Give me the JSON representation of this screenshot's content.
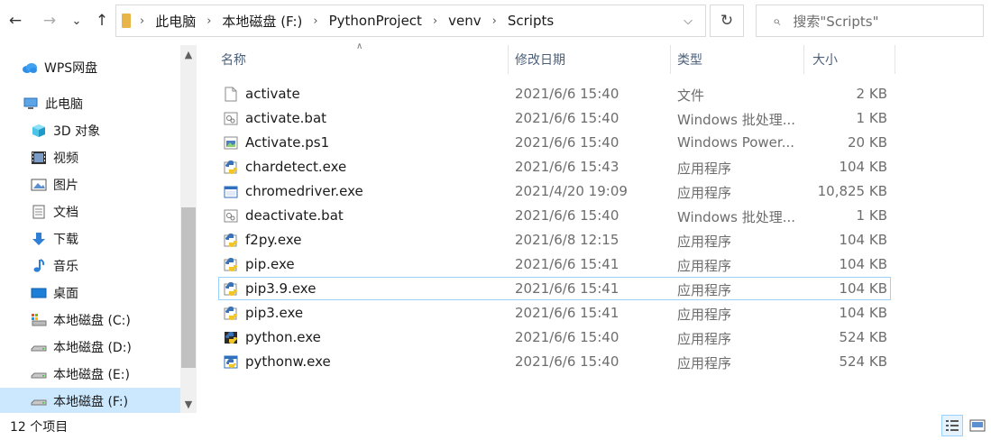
{
  "nav": {
    "back_glyph": "←",
    "forward_glyph": "→",
    "history_glyph": "⌄",
    "up_glyph": "↑",
    "refresh_glyph": "↻",
    "breadcrumbs": [
      "此电脑",
      "本地磁盘 (F:)",
      "PythonProject",
      "venv",
      "Scripts"
    ],
    "search_placeholder": "搜索\"Scripts\""
  },
  "sidebar": {
    "items": [
      {
        "label": "WPS网盘",
        "icon": "cloud-icon"
      },
      {
        "label": "此电脑",
        "icon": "computer-icon"
      },
      {
        "label": "3D 对象",
        "icon": "3d-objects-icon"
      },
      {
        "label": "视频",
        "icon": "video-icon"
      },
      {
        "label": "图片",
        "icon": "pictures-icon"
      },
      {
        "label": "文档",
        "icon": "documents-icon"
      },
      {
        "label": "下载",
        "icon": "download-icon"
      },
      {
        "label": "音乐",
        "icon": "music-icon"
      },
      {
        "label": "桌面",
        "icon": "desktop-icon"
      },
      {
        "label": "本地磁盘 (C:)",
        "icon": "system-drive-icon"
      },
      {
        "label": "本地磁盘 (D:)",
        "icon": "drive-icon"
      },
      {
        "label": "本地磁盘 (E:)",
        "icon": "drive-icon"
      },
      {
        "label": "本地磁盘 (F:)",
        "icon": "drive-icon",
        "selected": true
      }
    ]
  },
  "columns": {
    "name": "名称",
    "date": "修改日期",
    "type": "类型",
    "size": "大小"
  },
  "files": [
    {
      "name": "activate",
      "date": "2021/6/6 15:40",
      "type": "文件",
      "size": "2 KB",
      "icon": "file-icon"
    },
    {
      "name": "activate.bat",
      "date": "2021/6/6 15:40",
      "type": "Windows 批处理...",
      "size": "1 KB",
      "icon": "batch-file-icon"
    },
    {
      "name": "Activate.ps1",
      "date": "2021/6/6 15:40",
      "type": "Windows Power...",
      "size": "20 KB",
      "icon": "powershell-file-icon"
    },
    {
      "name": "chardetect.exe",
      "date": "2021/6/6 15:43",
      "type": "应用程序",
      "size": "104 KB",
      "icon": "python-exe-icon"
    },
    {
      "name": "chromedriver.exe",
      "date": "2021/4/20 19:09",
      "type": "应用程序",
      "size": "10,825 KB",
      "icon": "app-window-icon"
    },
    {
      "name": "deactivate.bat",
      "date": "2021/6/6 15:40",
      "type": "Windows 批处理...",
      "size": "1 KB",
      "icon": "batch-file-icon"
    },
    {
      "name": "f2py.exe",
      "date": "2021/6/8 12:15",
      "type": "应用程序",
      "size": "104 KB",
      "icon": "python-exe-icon"
    },
    {
      "name": "pip.exe",
      "date": "2021/6/6 15:41",
      "type": "应用程序",
      "size": "104 KB",
      "icon": "python-exe-icon"
    },
    {
      "name": "pip3.9.exe",
      "date": "2021/6/6 15:41",
      "type": "应用程序",
      "size": "104 KB",
      "icon": "python-exe-icon",
      "focused": true
    },
    {
      "name": "pip3.exe",
      "date": "2021/6/6 15:41",
      "type": "应用程序",
      "size": "104 KB",
      "icon": "python-exe-icon"
    },
    {
      "name": "python.exe",
      "date": "2021/6/6 15:40",
      "type": "应用程序",
      "size": "524 KB",
      "icon": "python-console-icon"
    },
    {
      "name": "pythonw.exe",
      "date": "2021/6/6 15:40",
      "type": "应用程序",
      "size": "524 KB",
      "icon": "python-window-icon"
    }
  ],
  "status": {
    "item_count": "12 个项目"
  },
  "colors": {
    "selection": "#cce8ff",
    "focus_border": "#99d1ff",
    "header_text": "#4c607a",
    "accent": "#0078d7"
  }
}
